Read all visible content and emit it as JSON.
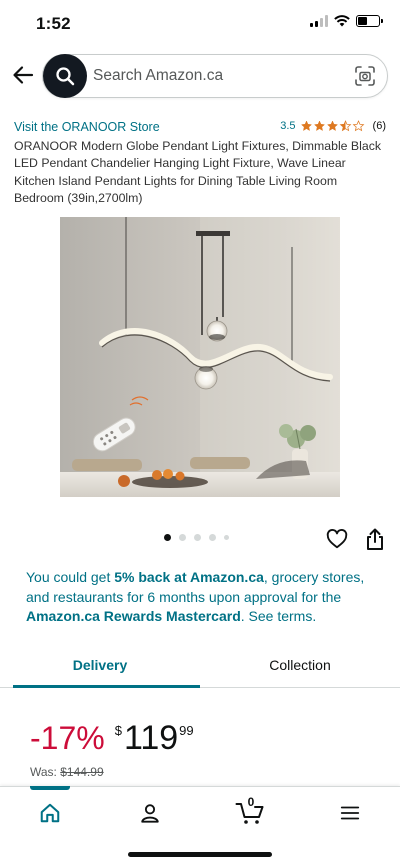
{
  "status_bar": {
    "time": "1:52"
  },
  "search": {
    "placeholder": "Search Amazon.ca"
  },
  "store": {
    "link": "Visit the ORANOOR Store"
  },
  "rating": {
    "value": "3.5",
    "stars": 3.5,
    "count": "(6)"
  },
  "product": {
    "title": "ORANOOR Modern Globe Pendant Light Fixtures, Dimmable Black LED Pendant Chandelier Hanging Light Fixture, Wave Linear Kitchen Island Pendant Lights for Dining Table Living Room Bedroom (39in,2700lm)"
  },
  "carousel": {
    "total_dots": 5,
    "active_index": 0
  },
  "icons": {
    "back": "arrow-left-icon",
    "search": "search-icon",
    "camera": "camera-scan-icon",
    "wishlist": "heart-icon",
    "share": "share-icon",
    "home": "home-icon",
    "account": "person-icon",
    "cart": "cart-icon",
    "menu": "hamburger-menu-icon"
  },
  "promo": {
    "part1": "You could get ",
    "bold1": "5% back at Amazon.ca",
    "part2": ", grocery stores, and restaurants for 6 months upon approval for the ",
    "bold2": "Amazon.ca Rewards Mastercard",
    "part3": ". See terms."
  },
  "tabs": [
    {
      "label": "Delivery",
      "active": true
    },
    {
      "label": "Collection",
      "active": false
    }
  ],
  "price": {
    "discount": "-17%",
    "currency": "$",
    "whole": "119",
    "fraction": "99",
    "was_label": "Was: ",
    "was_value": "$144.99"
  },
  "bottom_nav": {
    "cart_count": "0"
  },
  "colors": {
    "link": "#007185",
    "deal_red": "#cc0c39",
    "star": "#de7921",
    "search_button": "#131921"
  }
}
